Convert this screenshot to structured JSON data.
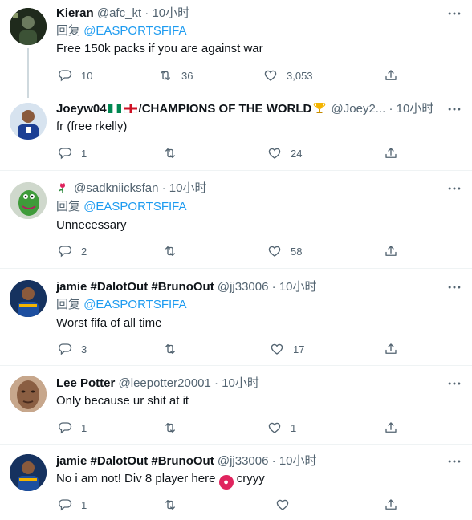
{
  "tweets": [
    {
      "name": "Kieran",
      "handle": "@afc_kt",
      "time": "10小时",
      "reply_prefix": "回复",
      "reply_to": "@EASPORTSFIFA",
      "text": "Free 150k packs if you are against war",
      "replies": "10",
      "retweets": "36",
      "likes": "3,053"
    },
    {
      "name": "Joeyw04",
      "name_suffix": "/CHAMPIONS OF THE WORLD",
      "handle": "@Joey2...",
      "time": "10小时",
      "text": "fr (free rkelly)",
      "replies": "1",
      "retweets": "",
      "likes": "24"
    },
    {
      "handle": "@sadkniicksfan",
      "time": "10小时",
      "reply_prefix": "回复",
      "reply_to": "@EASPORTSFIFA",
      "text": "Unnecessary",
      "replies": "2",
      "retweets": "",
      "likes": "58"
    },
    {
      "name": "jamie #DalotOut #BrunoOut",
      "handle": "@jj33006",
      "time": "10小时",
      "reply_prefix": "回复",
      "reply_to": "@EASPORTSFIFA",
      "text": "Worst fifa of all time",
      "replies": "3",
      "retweets": "",
      "likes": "17"
    },
    {
      "name": "Lee Potter",
      "handle": "@leepotter20001",
      "time": "10小时",
      "text": "Only because ur shit at it",
      "replies": "1",
      "retweets": "",
      "likes": "1"
    },
    {
      "name": "jamie #DalotOut #BrunoOut",
      "handle": "@jj33006",
      "time": "10小时",
      "text_before": "No i am not! Div 8 player here",
      "text_after": "cryyy",
      "replies": "1",
      "retweets": "",
      "likes": ""
    }
  ],
  "separator": "·",
  "icons": {
    "reply": "reply-icon",
    "retweet": "retweet-icon",
    "like": "heart-icon",
    "share": "share-icon",
    "more": "more-icon"
  },
  "colors": {
    "link": "#1d9bf0",
    "secondary": "#536471",
    "divider": "#eff3f4"
  }
}
